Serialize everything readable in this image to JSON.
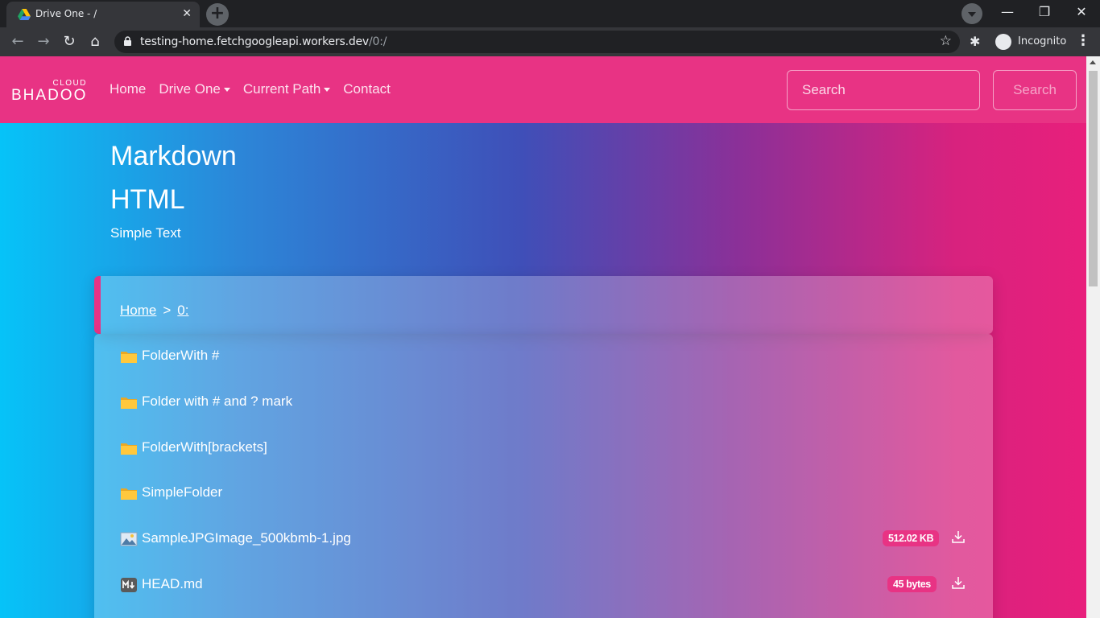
{
  "browser": {
    "tab_title": "Drive One - /",
    "tab_close": "✕",
    "new_tab": "+",
    "url_host": "testing-home.fetchgoogleapi.workers.dev",
    "url_path": "/0:/",
    "incognito_label": "Incognito",
    "window_controls": {
      "minimize": "—",
      "restore": "❐",
      "close": "✕"
    },
    "nav": {
      "back": "←",
      "forward": "→",
      "reload": "↻",
      "home": "⌂",
      "star": "☆",
      "extensions": "✱",
      "menu": "⋮"
    }
  },
  "navbar": {
    "brand_top": "CLOUD",
    "brand_main": "BHADOO",
    "links": [
      "Home",
      "Drive One",
      "Current Path",
      "Contact"
    ],
    "search_placeholder": "Search",
    "search_button": "Search"
  },
  "readme": {
    "heading1": "Markdown",
    "heading2": "HTML",
    "text": "Simple Text"
  },
  "breadcrumb": {
    "home": "Home",
    "separator": ">",
    "current": "0:"
  },
  "files": [
    {
      "name": "FolderWith #",
      "type": "folder",
      "icon": "folder-icon"
    },
    {
      "name": "Folder with # and ? mark",
      "type": "folder",
      "icon": "folder-icon"
    },
    {
      "name": "FolderWith[brackets]",
      "type": "folder",
      "icon": "folder-icon"
    },
    {
      "name": "SimpleFolder",
      "type": "folder",
      "icon": "folder-icon"
    },
    {
      "name": "SampleJPGImage_500kbmb-1.jpg",
      "type": "image",
      "icon": "image-file-icon",
      "size": "512.02 KB"
    },
    {
      "name": "HEAD.md",
      "type": "markdown",
      "icon": "markdown-file-icon",
      "size": "45 bytes"
    }
  ],
  "colors": {
    "accent_pink": "#e83384",
    "gradient_start": "#06c3f8",
    "gradient_mid": "#3f4fb8",
    "gradient_end": "#e81f7c"
  }
}
